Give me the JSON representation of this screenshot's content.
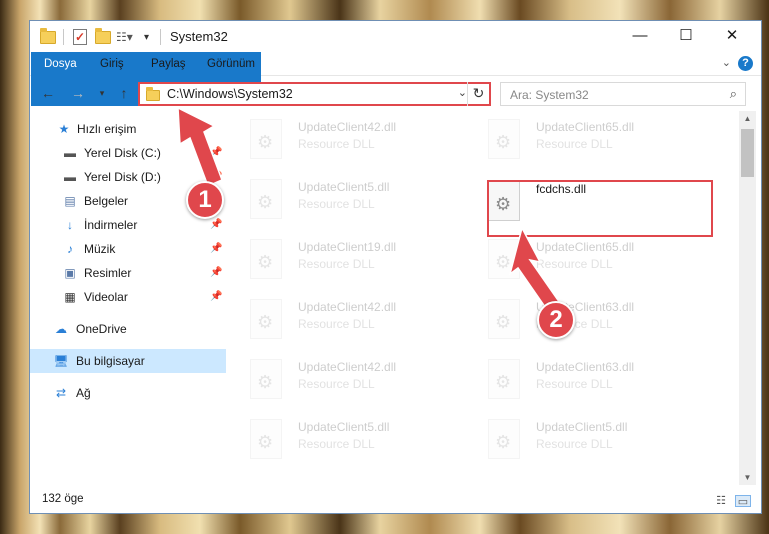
{
  "window": {
    "title": "System32",
    "controls": {
      "minimize": "—",
      "maximize": "☐",
      "close": "✕"
    }
  },
  "ribbon": {
    "tabs": [
      "Dosya",
      "Giriş",
      "Paylaş",
      "Görünüm"
    ],
    "help": "?"
  },
  "address": {
    "path": "C:\\Windows\\System32",
    "search_placeholder": "Ara: System32"
  },
  "nav": {
    "items": [
      {
        "label": "Hızlı erişim",
        "icon": "star-icon"
      },
      {
        "label": "Yerel Disk (C:)",
        "icon": "drive-icon",
        "pinned": true
      },
      {
        "label": "Yerel Disk (D:)",
        "icon": "drive-icon",
        "pinned": true
      },
      {
        "label": "Belgeler",
        "icon": "documents-icon",
        "pinned": true
      },
      {
        "label": "İndirmeler",
        "icon": "download-icon",
        "pinned": true
      },
      {
        "label": "Müzik",
        "icon": "music-icon",
        "pinned": true
      },
      {
        "label": "Resimler",
        "icon": "pictures-icon",
        "pinned": true
      },
      {
        "label": "Videolar",
        "icon": "videos-icon",
        "pinned": true
      },
      {
        "label": "OneDrive",
        "icon": "cloud-icon"
      },
      {
        "label": "Bu bilgisayar",
        "icon": "computer-icon",
        "selected": true
      },
      {
        "label": "Ağ",
        "icon": "network-icon"
      }
    ]
  },
  "files": {
    "left": [
      {
        "name": "UpdateClient42.dll",
        "desc": "Resource DLL"
      },
      {
        "name": "UpdateClient5.dll",
        "desc": "Resource DLL"
      },
      {
        "name": "UpdateClient19.dll",
        "desc": "Resource DLL"
      },
      {
        "name": "UpdateClient42.dll",
        "desc": "Resource DLL"
      },
      {
        "name": "UpdateClient42.dll",
        "desc": "Resource DLL"
      },
      {
        "name": "UpdateClient5.dll",
        "desc": "Resource DLL"
      }
    ],
    "right": [
      {
        "name": "UpdateClient65.dll",
        "desc": "Resource DLL"
      },
      {
        "name": "fcdchs.dll",
        "desc": ""
      },
      {
        "name": "UpdateClient65.dll",
        "desc": "Resource DLL"
      },
      {
        "name": "UpdateClient63.dll",
        "desc": "Resource DLL"
      },
      {
        "name": "UpdateClient63.dll",
        "desc": "Resource DLL"
      },
      {
        "name": "UpdateClient5.dll",
        "desc": "Resource DLL"
      }
    ]
  },
  "status": {
    "count": "132 öge"
  },
  "annotations": {
    "badge1": "1",
    "badge2": "2",
    "color": "#e0474c"
  }
}
